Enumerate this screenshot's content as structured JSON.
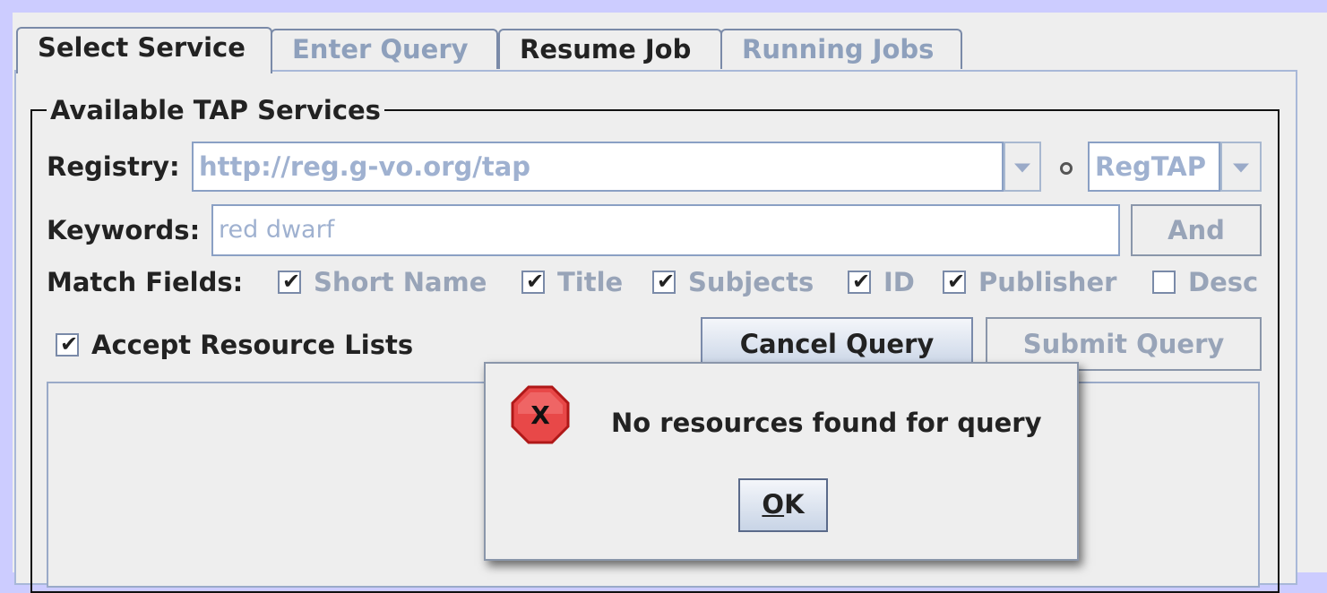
{
  "tabs": [
    {
      "label": "Select Service",
      "state": "active"
    },
    {
      "label": "Enter Query",
      "state": "disabled"
    },
    {
      "label": "Resume Job",
      "state": "enabled"
    },
    {
      "label": "Running Jobs",
      "state": "disabled"
    }
  ],
  "services_panel": {
    "title": "Available TAP Services",
    "registry_label": "Registry:",
    "registry_value": "http://reg.g-vo.org/tap",
    "protocol_value": "RegTAP",
    "keywords_label": "Keywords:",
    "keywords_value": "red dwarf",
    "and_or_label": "And",
    "match_fields_label": "Match Fields:",
    "match_fields": [
      {
        "label": "Short Name",
        "checked": true
      },
      {
        "label": "Title",
        "checked": true
      },
      {
        "label": "Subjects",
        "checked": true
      },
      {
        "label": "ID",
        "checked": true
      },
      {
        "label": "Publisher",
        "checked": true
      },
      {
        "label": "Desc",
        "checked": false
      }
    ],
    "accept_resource_lists_label": "Accept Resource Lists",
    "accept_resource_lists_checked": true,
    "cancel_query_label": "Cancel Query",
    "submit_query_label": "Submit Query"
  },
  "dialog": {
    "icon": "error-octagon-icon",
    "icon_glyph": "X",
    "message": "No resources found for query",
    "ok_mnemonic": "O",
    "ok_rest": "K"
  },
  "colors": {
    "background": "#ccccff",
    "panel": "#eeeeee",
    "disabled_text": "#98a4b8",
    "error_red": "#e84040"
  }
}
